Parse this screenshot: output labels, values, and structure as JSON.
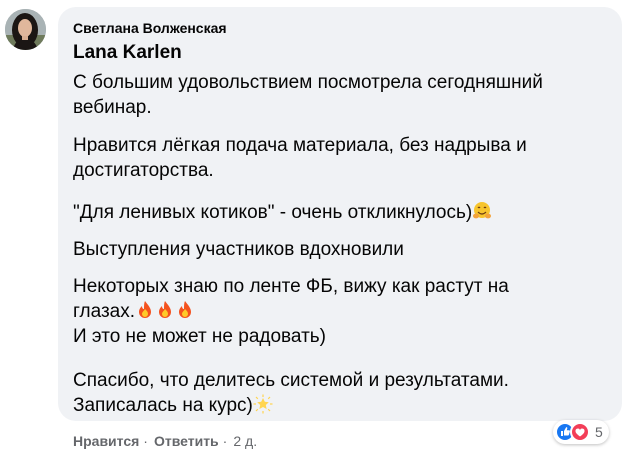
{
  "comment": {
    "author": "Светлана Волженская",
    "tagged_name": "Lana Karlen",
    "paragraphs": [
      {
        "lines": [
          "С большим удовольствием посмотрела сегодняшний",
          "вебинар."
        ]
      },
      {
        "lines": [
          "Нравится лёгкая подача материала, без надрыва и",
          "достигаторства."
        ]
      },
      {
        "lines": [
          "\"Для ленивых котиков\" - очень откликнулось)"
        ],
        "emoji": "hugging-face"
      },
      {
        "lines": [
          "Выступления участников вдохновили"
        ]
      },
      {
        "lines": [
          "Некоторых знаю по ленте ФБ, вижу как растут на",
          "глазах.",
          "И это не может не радовать)"
        ],
        "emoji": "fire-x3"
      },
      {
        "lines": [
          "Спасибо, что делитесь системой и результатами.",
          "Записалась на курс)"
        ],
        "emoji": "glowing-star"
      }
    ]
  },
  "actions": {
    "like_label": "Нравится",
    "reply_label": "Ответить",
    "time": "2 д."
  },
  "reactions": {
    "types": [
      "like-icon",
      "love-icon"
    ],
    "count": "5",
    "colors": {
      "like": "#1877f2",
      "love": "#f33e58"
    }
  }
}
